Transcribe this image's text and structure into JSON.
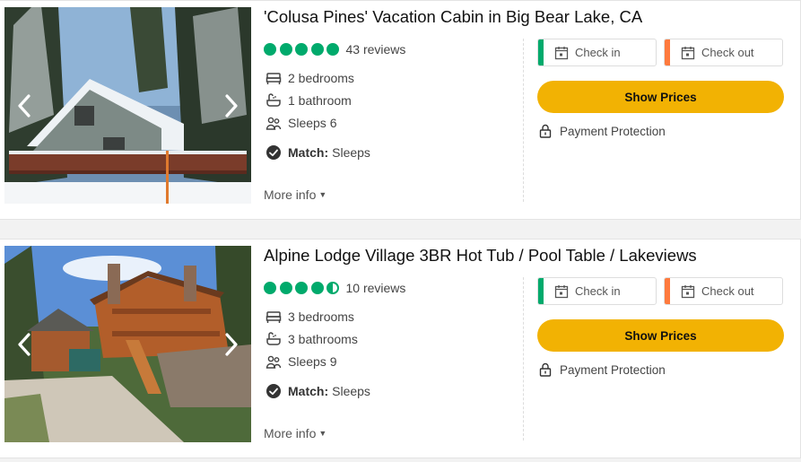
{
  "listings": [
    {
      "title": "'Colusa Pines' Vacation Cabin in Big Bear Lake, CA",
      "reviews": "43 reviews",
      "rating_bubbles": 5,
      "bedrooms": "2 bedrooms",
      "bathrooms": "1 bathroom",
      "sleeps": "Sleeps 6",
      "match_label": "Match:",
      "match_value": "Sleeps",
      "more_info": "More info",
      "check_in": "Check in",
      "check_out": "Check out",
      "show_prices": "Show Prices",
      "payment_protection": "Payment Protection"
    },
    {
      "title": "Alpine Lodge Village 3BR Hot Tub / Pool Table / Lakeviews",
      "reviews": "10 reviews",
      "rating_bubbles": 4.5,
      "bedrooms": "3 bedrooms",
      "bathrooms": "3 bathrooms",
      "sleeps": "Sleeps 9",
      "match_label": "Match:",
      "match_value": "Sleeps",
      "more_info": "More info",
      "check_in": "Check in",
      "check_out": "Check out",
      "show_prices": "Show Prices",
      "payment_protection": "Payment Protection"
    }
  ],
  "colors": {
    "rating_green": "#00aa6c",
    "checkin_accent": "#00aa6c",
    "checkout_accent": "#ff7a3d",
    "cta_yellow": "#f2b203"
  },
  "icons": [
    "chevron-left-icon",
    "chevron-right-icon",
    "bed-icon",
    "bath-icon",
    "people-icon",
    "check-circle-icon",
    "caret-down-icon",
    "calendar-icon",
    "lock-icon"
  ]
}
